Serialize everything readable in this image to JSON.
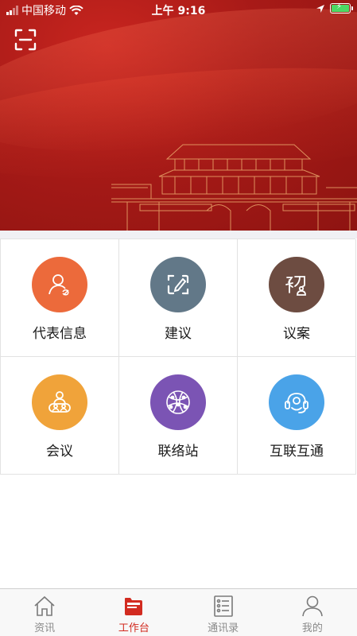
{
  "status_bar": {
    "carrier": "中国移动",
    "time": "上午 9:16"
  },
  "banner": {
    "scan_icon": "scan-icon",
    "accent": "#a71a17"
  },
  "menu": {
    "items": [
      {
        "label": "代表信息",
        "icon": "representative-icon",
        "color": "#ec6a3b"
      },
      {
        "label": "建议",
        "icon": "edit-icon",
        "color": "#627888"
      },
      {
        "label": "议案",
        "icon": "motion-icon",
        "color": "#6d4c41"
      },
      {
        "label": "会议",
        "icon": "meeting-icon",
        "color": "#f0a33a"
      },
      {
        "label": "联络站",
        "icon": "network-icon",
        "color": "#7b54b4"
      },
      {
        "label": "互联互通",
        "icon": "headset-icon",
        "color": "#4aa3e8"
      }
    ]
  },
  "tabbar": {
    "tabs": [
      {
        "label": "资讯",
        "icon": "home-icon",
        "active": false
      },
      {
        "label": "工作台",
        "icon": "workbench-icon",
        "active": true
      },
      {
        "label": "通讯录",
        "icon": "contacts-icon",
        "active": false
      },
      {
        "label": "我的",
        "icon": "profile-icon",
        "active": false
      }
    ],
    "active_color": "#d22b20",
    "inactive_color": "#8a8a8a"
  }
}
